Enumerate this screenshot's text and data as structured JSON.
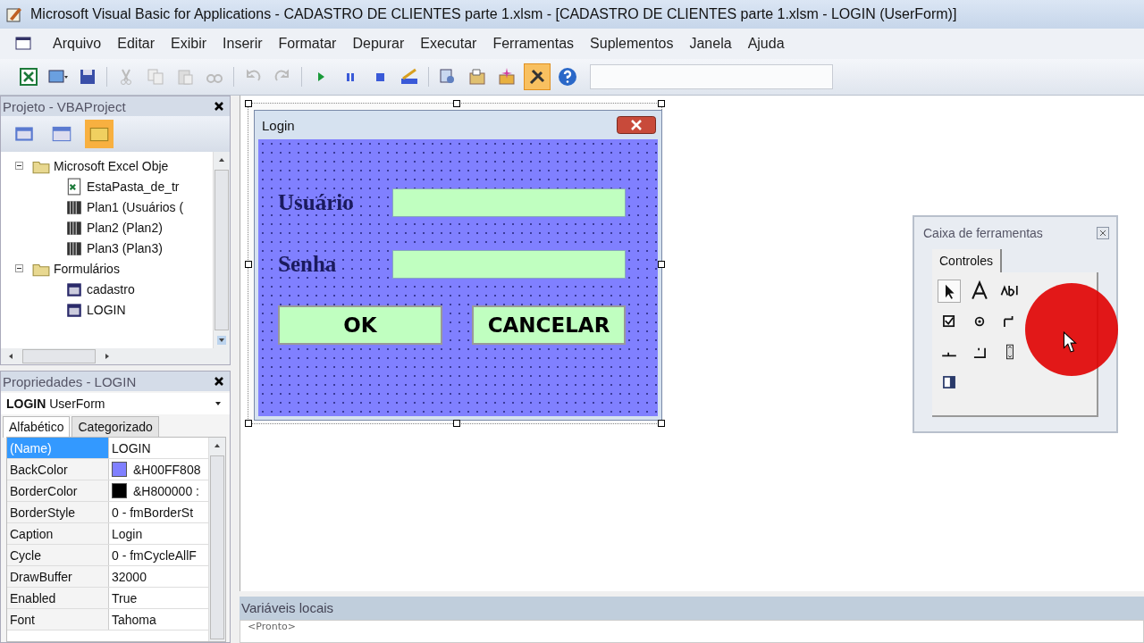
{
  "window": {
    "title": "Microsoft Visual Basic for Applications - CADASTRO DE CLIENTES parte 1.xlsm - [CADASTRO DE CLIENTES parte 1.xlsm - LOGIN (UserForm)]"
  },
  "menu": [
    "Arquivo",
    "Editar",
    "Exibir",
    "Inserir",
    "Formatar",
    "Depurar",
    "Executar",
    "Ferramentas",
    "Suplementos",
    "Janela",
    "Ajuda"
  ],
  "toolbar": [
    [
      {
        "kind": "excel",
        "selected": false
      },
      {
        "kind": "insert",
        "selected": false
      },
      {
        "kind": "save",
        "selected": false
      }
    ],
    [
      {
        "kind": "cut",
        "selected": false
      },
      {
        "kind": "copy",
        "selected": false
      },
      {
        "kind": "paste",
        "selected": false
      },
      {
        "kind": "find",
        "selected": false
      }
    ],
    [
      {
        "kind": "undo",
        "selected": false
      },
      {
        "kind": "redo",
        "selected": false
      }
    ],
    [
      {
        "kind": "run",
        "selected": false
      },
      {
        "kind": "pause",
        "selected": false
      },
      {
        "kind": "stop",
        "selected": false
      },
      {
        "kind": "design",
        "selected": false
      }
    ],
    [
      {
        "kind": "explorer",
        "selected": false
      },
      {
        "kind": "props",
        "selected": false
      },
      {
        "kind": "browser",
        "selected": false
      },
      {
        "kind": "toolbox",
        "selected": true
      },
      {
        "kind": "help",
        "selected": false
      }
    ]
  ],
  "project": {
    "title": "Projeto - VBAProject",
    "buttons": [
      {
        "kind": "code",
        "selected": false
      },
      {
        "kind": "object",
        "selected": false
      },
      {
        "kind": "folders",
        "selected": true
      }
    ],
    "tree": [
      {
        "label": "Microsoft Excel Obje",
        "kind": "folder",
        "expanded": true,
        "children": [
          {
            "label": "EstaPasta_de_tr",
            "kind": "workbook"
          },
          {
            "label": "Plan1 (Usuários (",
            "kind": "sheet"
          },
          {
            "label": "Plan2 (Plan2)",
            "kind": "sheet"
          },
          {
            "label": "Plan3 (Plan3)",
            "kind": "sheet"
          }
        ]
      },
      {
        "label": "Formulários",
        "kind": "folder",
        "expanded": true,
        "children": [
          {
            "label": "cadastro",
            "kind": "form"
          },
          {
            "label": "LOGIN",
            "kind": "form"
          }
        ]
      }
    ]
  },
  "properties": {
    "title": "Propriedades - LOGIN",
    "object_name": "LOGIN",
    "object_type": "UserForm",
    "tabs": [
      {
        "label": "Alfabético",
        "selected": true
      },
      {
        "label": "Categorizado",
        "selected": false
      }
    ],
    "rows": [
      {
        "name": "(Name)",
        "value": "LOGIN",
        "selected": true
      },
      {
        "name": "BackColor",
        "value": "&H00FF808",
        "color": "#8080ff",
        "selected": false
      },
      {
        "name": "BorderColor",
        "value": "&H800000 :",
        "color": "#000000",
        "selected": false
      },
      {
        "name": "BorderStyle",
        "value": "0 - fmBorderSt",
        "selected": false
      },
      {
        "name": "Caption",
        "value": "Login",
        "selected": false
      },
      {
        "name": "Cycle",
        "value": "0 - fmCycleAllF",
        "selected": false
      },
      {
        "name": "DrawBuffer",
        "value": "32000",
        "selected": false
      },
      {
        "name": "Enabled",
        "value": "True",
        "selected": false
      },
      {
        "name": "Font",
        "value": "Tahoma",
        "selected": false
      }
    ]
  },
  "form": {
    "caption": "Login",
    "fields": [
      {
        "label": "Usuário"
      },
      {
        "label": "Senha"
      }
    ],
    "buttons": [
      "OK",
      "CANCELAR"
    ]
  },
  "toolbox": {
    "title": "Caixa de ferramentas",
    "tab": "Controles",
    "tool_rows": [
      [
        {
          "kind": "pointer",
          "selected": true
        },
        {
          "kind": "label",
          "selected": false
        },
        {
          "kind": "textbox",
          "selected": false
        }
      ],
      [
        {
          "kind": "check",
          "selected": false
        },
        {
          "kind": "option",
          "selected": false
        },
        {
          "kind": "toggle",
          "selected": false
        }
      ],
      [
        {
          "kind": "tabstrip",
          "selected": false
        },
        {
          "kind": "multipage",
          "selected": false
        },
        {
          "kind": "scroll",
          "selected": false
        }
      ],
      [
        {
          "kind": "refedit",
          "selected": false
        }
      ]
    ]
  },
  "locals": {
    "title": "Variáveis locais",
    "status": "<Pronto>"
  }
}
